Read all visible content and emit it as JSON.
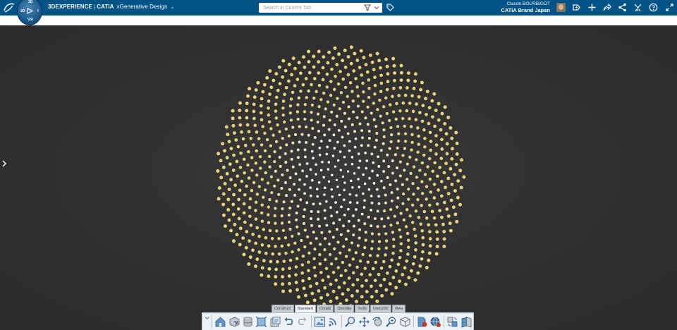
{
  "topbar": {
    "brand_prefix": "3DEXPERIENCE",
    "brand_product": "CATIA",
    "app_name": "xGenerative Design",
    "compass_labels": {
      "top": "3D",
      "left": "3D",
      "right": "f",
      "bottom": "V,R"
    },
    "search_placeholder": "Search in Current Tab",
    "user_name": "Claude BOURBIGOT",
    "user_org": "CATIA Brand Japan",
    "icons": [
      "ds-logo-icon",
      "filter-icon",
      "chevron-down-icon",
      "tag-icon",
      "avatar",
      "add-content-icon",
      "plus-icon",
      "share-icon",
      "network-icon",
      "compass-tool-icon",
      "help-icon",
      "expand-icon"
    ]
  },
  "colors": {
    "topbar": "#005386",
    "viewport": "#2d2d2d",
    "seed_outer": "#e8d27a",
    "seed_inner": "#ffffff"
  },
  "viewport": {
    "pattern": "phyllotaxis sunflower seed arrangement",
    "seed_count": 1000
  },
  "action_bar": {
    "tabs": [
      "Construct",
      "Standard",
      "Create",
      "Operate",
      "Tools",
      "Lifecycle",
      "View"
    ],
    "active_tab": "Standard",
    "tools": [
      "home-icon",
      "save-icon",
      "database-icon",
      "fit-all-icon",
      "clipboard-icon",
      "undo-icon",
      "redo-icon",
      "image-view-icon",
      "feed-icon",
      "zoom-icon",
      "pan-icon",
      "rotate-icon",
      "zoom-area-icon",
      "box-view-icon",
      "publish-icon",
      "settings-globe-icon",
      "sync-icon",
      "book-icon"
    ]
  }
}
